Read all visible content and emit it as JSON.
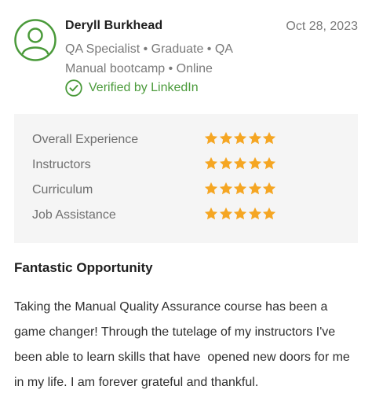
{
  "reviewer": {
    "name": "Deryll Burkhead",
    "meta": "QA Specialist • Graduate • QA Manual bootcamp • Online",
    "verified_label": "Verified by LinkedIn",
    "avatar_icon": "user-avatar-icon"
  },
  "review": {
    "date": "Oct 28, 2023",
    "title": "Fantastic Opportunity",
    "body": "Taking the Manual Quality Assurance course has been a game changer! Through the tutelage of my instructors I've been able to learn skills that have  opened new doors for me in my life. I am forever grateful and thankful."
  },
  "ratings": [
    {
      "label": "Overall Experience",
      "stars": 5,
      "max": 5
    },
    {
      "label": "Instructors",
      "stars": 5,
      "max": 5
    },
    {
      "label": "Curriculum",
      "stars": 5,
      "max": 5
    },
    {
      "label": "Job Assistance",
      "stars": 5,
      "max": 5
    }
  ],
  "colors": {
    "accent_green": "#4a9a3a",
    "star_orange": "#f5a623",
    "panel_bg": "#f5f5f5"
  }
}
